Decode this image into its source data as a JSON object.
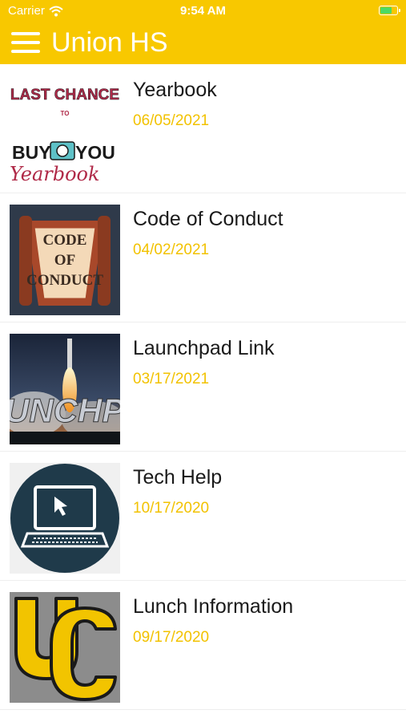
{
  "status_bar": {
    "carrier": "Carrier",
    "time": "9:54 AM"
  },
  "header": {
    "title": "Union HS",
    "menu_icon": "hamburger-menu-icon"
  },
  "colors": {
    "header": "#f8c800",
    "date": "#f2c200"
  },
  "items": [
    {
      "title": "Yearbook",
      "date": "06/05/2021",
      "thumb_text": {
        "line1": "LAST CHANCE",
        "line2": "TO",
        "line3_left": "BUY",
        "line3_right": "YOU",
        "script": "Yearbook"
      }
    },
    {
      "title": "Code of Conduct",
      "date": "04/02/2021",
      "thumb_text": {
        "line1": "CODE",
        "line2": "OF",
        "line3": "CONDUCT"
      }
    },
    {
      "title": "Launchpad Link",
      "date": "03/17/2021",
      "thumb_text": {
        "word": "UNCHP"
      }
    },
    {
      "title": "Tech Help",
      "date": "10/17/2020"
    },
    {
      "title": "Lunch Information",
      "date": "09/17/2020"
    }
  ]
}
